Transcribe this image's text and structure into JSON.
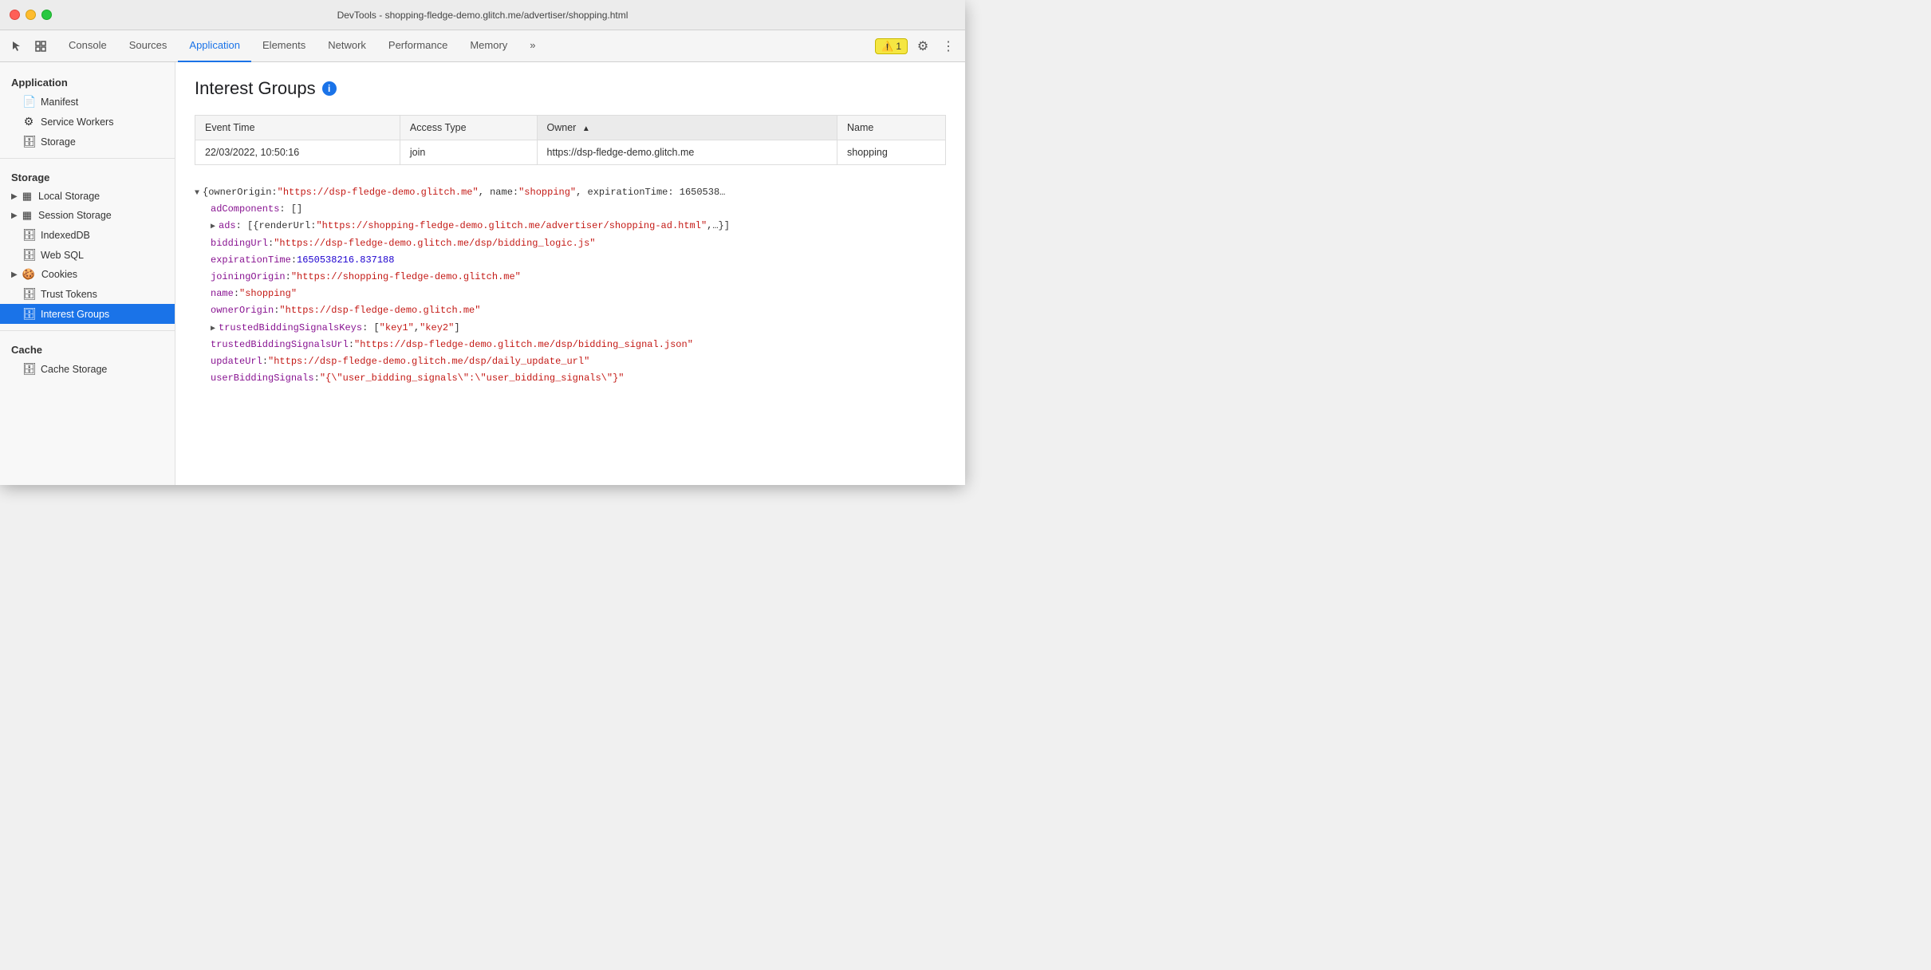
{
  "titlebar": {
    "title": "DevTools - shopping-fledge-demo.glitch.me/advertiser/shopping.html"
  },
  "tabs": {
    "items": [
      {
        "label": "Console",
        "active": false
      },
      {
        "label": "Sources",
        "active": false
      },
      {
        "label": "Application",
        "active": true
      },
      {
        "label": "Elements",
        "active": false
      },
      {
        "label": "Network",
        "active": false
      },
      {
        "label": "Performance",
        "active": false
      },
      {
        "label": "Memory",
        "active": false
      }
    ],
    "more_label": "»",
    "warning_count": "1"
  },
  "sidebar": {
    "application_section": "Application",
    "items_application": [
      {
        "label": "Manifest",
        "icon": "📄"
      },
      {
        "label": "Service Workers",
        "icon": "⚙"
      },
      {
        "label": "Storage",
        "icon": "🗄"
      }
    ],
    "storage_section": "Storage",
    "local_storage_label": "Local Storage",
    "session_storage_label": "Session Storage",
    "indexeddb_label": "IndexedDB",
    "websql_label": "Web SQL",
    "cookies_label": "Cookies",
    "trust_tokens_label": "Trust Tokens",
    "interest_groups_label": "Interest Groups",
    "cache_section": "Cache",
    "cache_storage_label": "Cache Storage"
  },
  "content": {
    "title": "Interest Groups",
    "table": {
      "columns": [
        "Event Time",
        "Access Type",
        "Owner",
        "Name"
      ],
      "rows": [
        {
          "event_time": "22/03/2022, 10:50:16",
          "access_type": "join",
          "owner": "https://dsp-fledge-demo.glitch.me",
          "name": "shopping"
        }
      ]
    },
    "json": {
      "root_preview": "{ownerOrigin: \"https://dsp-fledge-demo.glitch.me\", name: \"shopping\", expirationTime: 1650538...",
      "ad_components": "adComponents: []",
      "ads_line": "ads: [{renderUrl: \"https://shopping-fledge-demo.glitch.me/advertiser/shopping-ad.html\",...}]",
      "bidding_url_key": "biddingUrl:",
      "bidding_url_val": "\"https://dsp-fledge-demo.glitch.me/dsp/bidding_logic.js\"",
      "expiration_key": "expirationTime:",
      "expiration_val": "1650538216.837188",
      "joining_origin_key": "joiningOrigin:",
      "joining_origin_val": "\"https://shopping-fledge-demo.glitch.me\"",
      "name_key": "name:",
      "name_val": "\"shopping\"",
      "owner_origin_key": "ownerOrigin:",
      "owner_origin_val": "\"https://dsp-fledge-demo.glitch.me\"",
      "trusted_keys_line": "trustedBiddingSignalsKeys: [\"key1\", \"key2\"]",
      "trusted_url_key": "trustedBiddingSignalsUrl:",
      "trusted_url_val": "\"https://dsp-fledge-demo.glitch.me/dsp/bidding_signal.json\"",
      "update_url_key": "updateUrl:",
      "update_url_val": "\"https://dsp-fledge-demo.glitch.me/dsp/daily_update_url\"",
      "user_bidding_key": "userBiddingSignals:",
      "user_bidding_val": "\"{\\\"user_bidding_signals\\\":\\\"user_bidding_signals\\\"}\""
    }
  }
}
